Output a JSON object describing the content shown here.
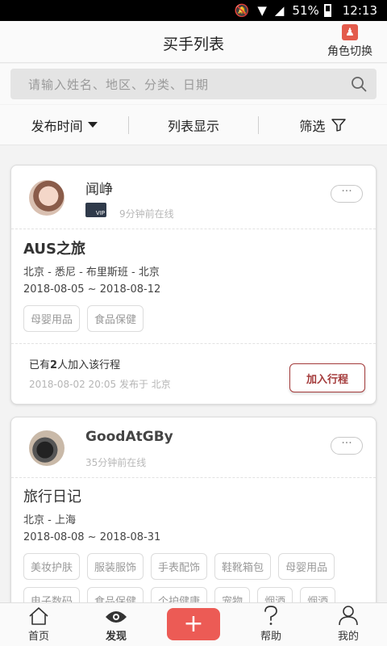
{
  "status_bar": {
    "battery": "51%",
    "time": "12:13"
  },
  "header": {
    "title": "买手列表",
    "role_switch_label": "角色切换"
  },
  "search": {
    "placeholder": "请输入姓名、地区、分类、日期"
  },
  "filters": {
    "publish_time": "发布时间",
    "list_view": "列表显示",
    "filter": "筛选"
  },
  "cards": [
    {
      "user": "闻峥",
      "vip_label": "VIP",
      "online": "9分钟前在线",
      "title": "AUS之旅",
      "route": "北京 - 悉尼 - 布里斯班 - 北京",
      "dates": "2018-08-05 ~ 2018-08-12",
      "tags": [
        "母婴用品",
        "食品保健"
      ],
      "joined_prefix": "已有",
      "joined_count": "2",
      "joined_suffix": "人加入该行程",
      "posted": "2018-08-02 20:05 发布于 北京",
      "join_button": "加入行程",
      "more": "···"
    },
    {
      "user": "GoodAtGBy",
      "online": "35分钟前在线",
      "title": "旅行日记",
      "route": "北京 - 上海",
      "dates": "2018-08-08 ~ 2018-08-31",
      "tags": [
        "美妆护肤",
        "服装服饰",
        "手表配饰",
        "鞋靴箱包",
        "母婴用品",
        "电子数码",
        "食品保健",
        "个护健康",
        "宠物",
        "烟酒",
        "烟酒"
      ],
      "more": "···"
    }
  ],
  "nav": {
    "home": "首页",
    "discover": "发现",
    "add": "+",
    "help": "帮助",
    "mine": "我的"
  }
}
